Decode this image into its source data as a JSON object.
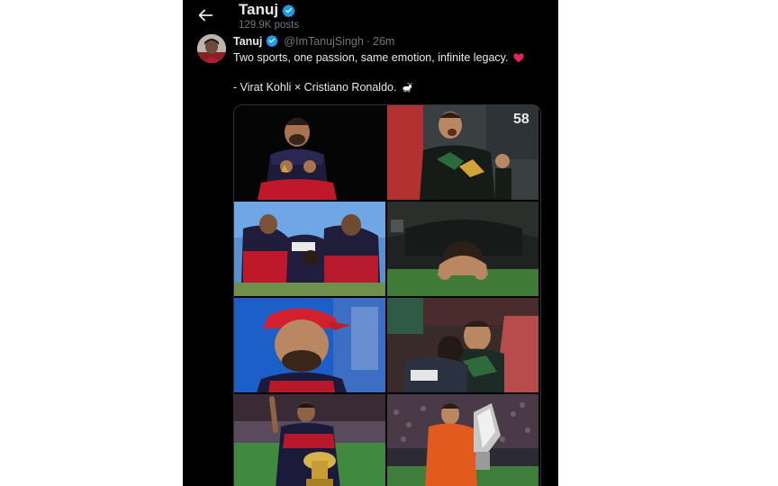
{
  "header": {
    "name": "Tanuj",
    "posts": "129.9K posts"
  },
  "tweet": {
    "name": "Tanuj",
    "handle": "@ImTanujSingh",
    "separator": "·",
    "time": "26m",
    "text_line1": "Two sports, one passion, same emotion, infinite legacy.",
    "text_line2": "- Virat Kohli × Cristiano Ronaldo.",
    "emoji1": "heart-emoji",
    "emoji2": "goat-emoji"
  },
  "media": {
    "photos": [
      "kohli-celebration-kneeling",
      "ronaldo-celebration-shouting",
      "kohli-on-ground-teammates",
      "ronaldo-face-down-grass",
      "kohli-emotional-red-cap",
      "ronaldo-hug-smiling",
      "kohli-with-trophy",
      "ronaldo-with-trophy"
    ],
    "jersey_number": "58"
  },
  "colors": {
    "background": "#000000",
    "text_primary": "#e7e9ea",
    "text_secondary": "#71767b",
    "verified": "#1d9bf0",
    "heart": "#f91880"
  }
}
